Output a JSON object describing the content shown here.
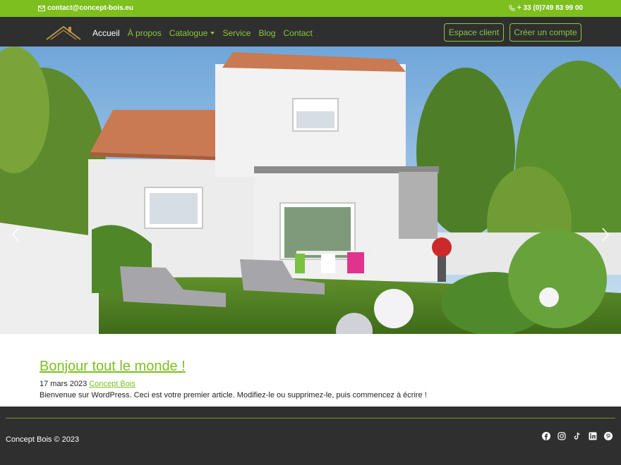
{
  "topbar": {
    "email": "contact@concept-bois.eu",
    "phone": "+ 33 (0)749 83 99 00",
    "email_icon": "envelope-icon",
    "phone_icon": "phone-icon"
  },
  "navbar": {
    "logo_icon": "house-roof-logo",
    "links": [
      {
        "label": "Accueil",
        "active": true
      },
      {
        "label": "À propos"
      },
      {
        "label": "Catalogue",
        "dropdown": true
      },
      {
        "label": "Service"
      },
      {
        "label": "Blog"
      },
      {
        "label": "Contact"
      }
    ],
    "espace_client": "Espace client",
    "creer_compte": "Créer un compte"
  },
  "hero": {
    "image_icon": "house-garden-photo",
    "prev_icon": "chevron-left-icon",
    "next_icon": "chevron-right-icon"
  },
  "post": {
    "title": "Bonjour tout le monde !",
    "date": "17 mars 2023",
    "author": "Concept Bois",
    "excerpt": "Bienvenue sur WordPress. Ceci est votre premier article. Modifiez-le ou supprimez-le, puis commencez à écrire !"
  },
  "footer": {
    "copyright": "Concept Bois © 2023",
    "social": [
      "facebook-icon",
      "instagram-icon",
      "tiktok-icon",
      "linkedin-icon",
      "pinterest-icon"
    ]
  },
  "colors": {
    "accent": "#7cbf1f",
    "nav_link": "#8cc63f",
    "dark": "#2f2f2f"
  }
}
